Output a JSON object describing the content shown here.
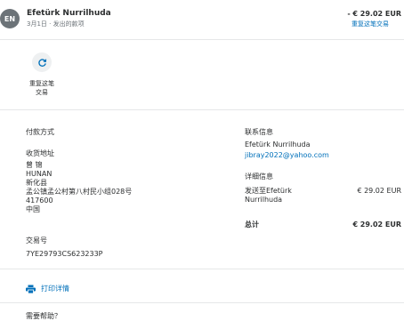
{
  "header": {
    "avatar_initials": "EN",
    "name": "Efetürk Nurrilhuda",
    "subline": "3月1日 · 发出的款项",
    "amount": "- € 29.02 EUR",
    "repeat_link": "重复这笔交易"
  },
  "actions": [
    {
      "label": "重复这笔交易",
      "icon": "refresh-icon"
    }
  ],
  "payment": {
    "method_label": "付款方式",
    "shipping_label": "收货地址",
    "address_lines": [
      "曾 锦",
      "HUNAN",
      "新化县",
      "孟公镇孟公村第八村民小组028号",
      "417600",
      "中国"
    ],
    "transaction_label": "交易号",
    "transaction_id": "7YE29793CS623233P"
  },
  "contact": {
    "label": "联系信息",
    "name": "Efetürk Nurrilhuda",
    "email": "jibray2022@yahoo.com"
  },
  "details": {
    "label": "详细信息",
    "sent_to_line1": "发送至Efetürk",
    "sent_to_line2": "Nurrilhuda",
    "sent_amount": "€ 29.02 EUR",
    "total_label": "总计",
    "total_amount": "€ 29.02 EUR"
  },
  "print": {
    "label": "打印详情",
    "icon": "printer-icon"
  },
  "help": {
    "label": "需要帮助？"
  },
  "colors": {
    "accent": "#0070ba",
    "avatar": "#6c7378",
    "text": "#2c2e2f"
  }
}
